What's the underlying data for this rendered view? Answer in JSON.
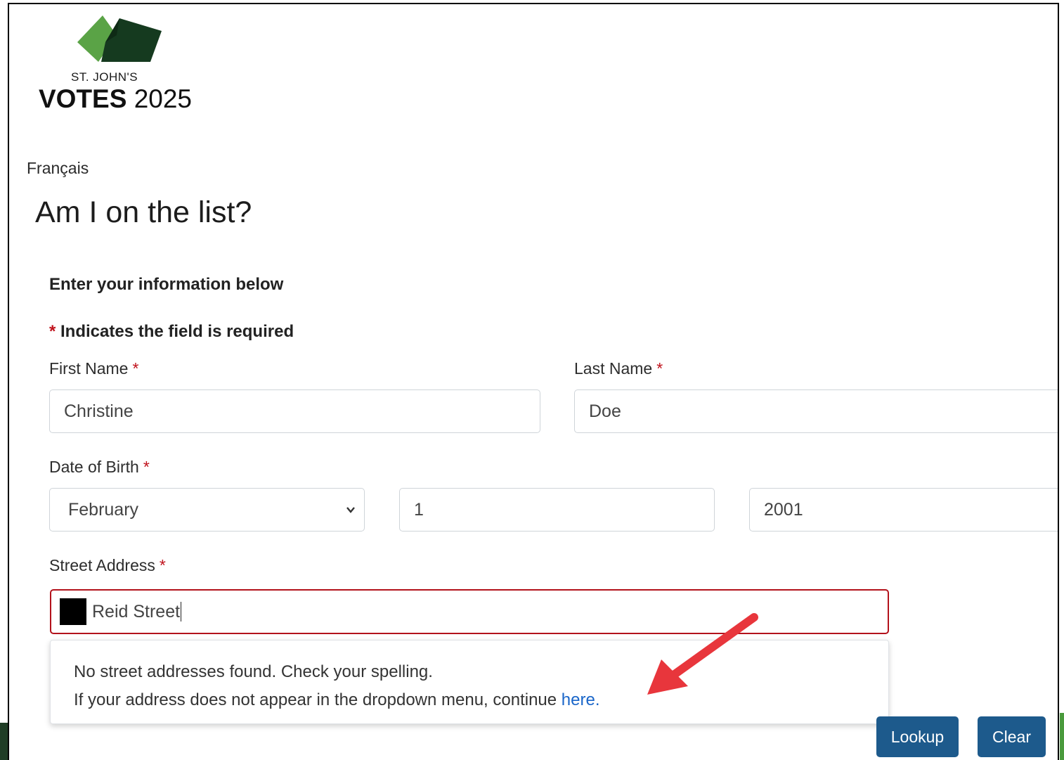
{
  "logo": {
    "small_text": "ST. JOHN'S",
    "big_bold": "VOTES",
    "big_year": "2025",
    "colors": {
      "light_green": "#5aa346",
      "dark_green": "#153a1f"
    }
  },
  "language_link": "Français",
  "page_title": "Am I on the list?",
  "intro": "Enter your information below",
  "required_note": {
    "star": "*",
    "text": "Indicates the field is required"
  },
  "fields": {
    "first_name": {
      "label": "First Name",
      "star": "*",
      "value": "Christine"
    },
    "last_name": {
      "label": "Last Name",
      "star": "*",
      "value": "Doe"
    },
    "dob": {
      "label": "Date of Birth",
      "star": "*",
      "month": "February",
      "day": "1",
      "year": "2001"
    },
    "street": {
      "label": "Street Address",
      "star": "*",
      "value": "Reid Street"
    }
  },
  "dropdown": {
    "line1": "No street addresses found. Check your spelling.",
    "line2_prefix": "If your address does not appear in the dropdown menu, continue ",
    "link_text": "here."
  },
  "buttons": {
    "lookup": "Lookup",
    "clear": "Clear"
  },
  "colors": {
    "button": "#1d5a8c",
    "required": "#c0121c",
    "error_border": "#b3121b",
    "link": "#1a66c9",
    "arrow": "#e8363c"
  }
}
